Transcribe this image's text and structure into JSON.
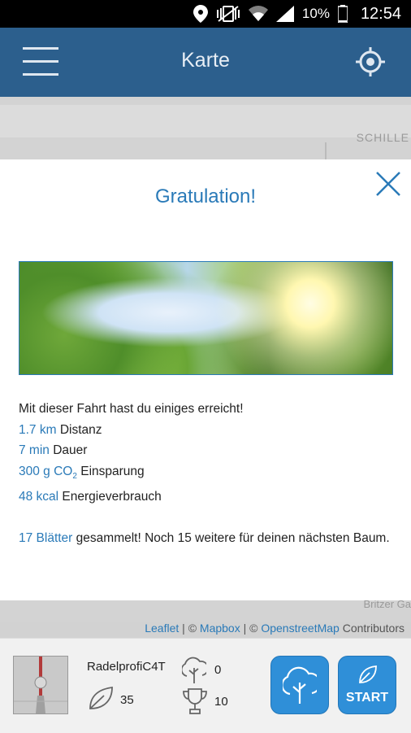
{
  "status_bar": {
    "battery": "10%",
    "time": "12:54",
    "icons": [
      "location-icon",
      "vibrate-icon",
      "wifi-icon",
      "signal-icon",
      "battery-icon"
    ]
  },
  "app_bar": {
    "title": "Karte",
    "menu_icon": "hamburger-menu-icon",
    "locate_icon": "locate-crosshair-icon",
    "background": "#2c5f8d"
  },
  "map": {
    "street_label_top": "SCHILLE",
    "street_label_bottom": "Britzer Ga",
    "attribution": {
      "leaflet": "Leaflet",
      "sep1": " | © ",
      "mapbox": "Mapbox",
      "sep2": " | © ",
      "osm": "OpenstreetMap",
      "contributors": " Contributors"
    }
  },
  "dialog": {
    "title": "Gratulation!",
    "close_icon": "close-x-icon",
    "intro": "Mit dieser Fahrt hast du einiges erreicht!",
    "stats": [
      {
        "value": "1.7 km",
        "label": " Distanz"
      },
      {
        "value": "7 min",
        "label": " Dauer"
      },
      {
        "value_main": "300 g CO",
        "value_sub": "2",
        "label": " Einsparung"
      },
      {
        "value": "48 kcal",
        "label": " Energieverbrauch"
      }
    ],
    "leaves_value": "17 Blätter",
    "leaves_text": " gesammelt! Noch 15 weitere für deinen nächsten Baum.",
    "accent": "#2a7ab8"
  },
  "bottom_bar": {
    "username": "RadelprofiC4T",
    "trees_count": "0",
    "leaves_count": "35",
    "trophies_count": "10",
    "start_label": "START",
    "button_color": "#2f8fd8"
  }
}
